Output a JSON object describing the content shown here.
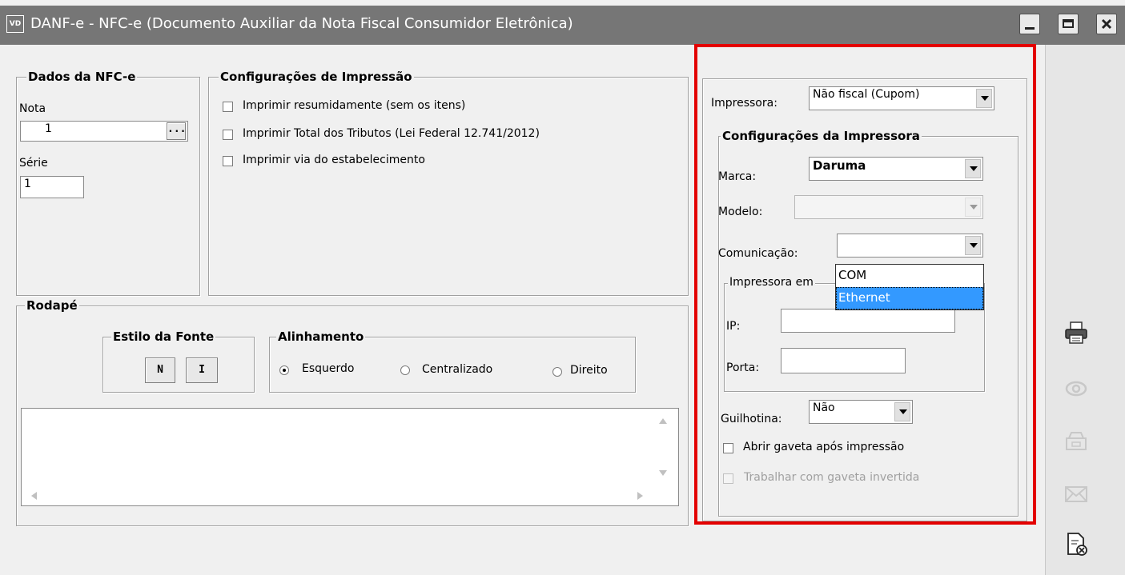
{
  "window": {
    "app_icon_text": "VD",
    "title": "DANF-e - NFC-e (Documento Auxiliar da Nota Fiscal Consumidor Eletrônica)",
    "controls": [
      "minimize-icon",
      "maximize-icon",
      "close-icon"
    ]
  },
  "dados": {
    "legend": "Dados da NFC-e",
    "nota_label": "Nota",
    "nota_value": "1",
    "ellipsis": "...",
    "serie_label": "Série",
    "serie_value": "1"
  },
  "impressao": {
    "legend": "Configurações de Impressão",
    "options": [
      {
        "label": "Imprimir resumidamente (sem os itens)",
        "checked": false
      },
      {
        "label": "Imprimir Total dos Tributos (Lei Federal 12.741/2012)",
        "checked": false
      },
      {
        "label": "Imprimir via do estabelecimento",
        "checked": false
      }
    ]
  },
  "rodape": {
    "legend": "Rodapé",
    "estilo_legend": "Estilo da Fonte",
    "bold_button": "N",
    "italic_button": "I",
    "alinhamento_legend": "Alinhamento",
    "align_options": [
      {
        "label": "Esquerdo",
        "selected": true
      },
      {
        "label": "Centralizado",
        "selected": false
      },
      {
        "label": "Direito",
        "selected": false
      }
    ],
    "text_value": ""
  },
  "printer": {
    "impressora_label": "Impressora:",
    "impressora_value": "Não fiscal (Cupom)",
    "config_legend": "Configurações da Impressora",
    "marca_label": "Marca:",
    "marca_value": "Daruma",
    "modelo_label": "Modelo:",
    "modelo_value": "",
    "comunicacao_label": "Comunicação:",
    "comunicacao_value": "",
    "comunicacao_options": [
      "COM",
      "Ethernet"
    ],
    "comunicacao_highlighted": "Ethernet",
    "rede_legend": "Impressora em",
    "ip_label": "IP:",
    "ip_value": "",
    "porta_label": "Porta:",
    "porta_value": "",
    "guilhotina_label": "Guilhotina:",
    "guilhotina_value": "Não",
    "gaveta_label": "Abrir gaveta após impressão",
    "gaveta_invertida_label": "Trabalhar com gaveta invertida"
  },
  "toolbar": {
    "icons": [
      "printer-icon",
      "eye-icon",
      "cash-drawer-icon",
      "envelope-icon",
      "close-document-icon"
    ]
  },
  "colors": {
    "highlight_border": "#e30000",
    "selection": "#3399ff",
    "titlebar": "#767676"
  }
}
